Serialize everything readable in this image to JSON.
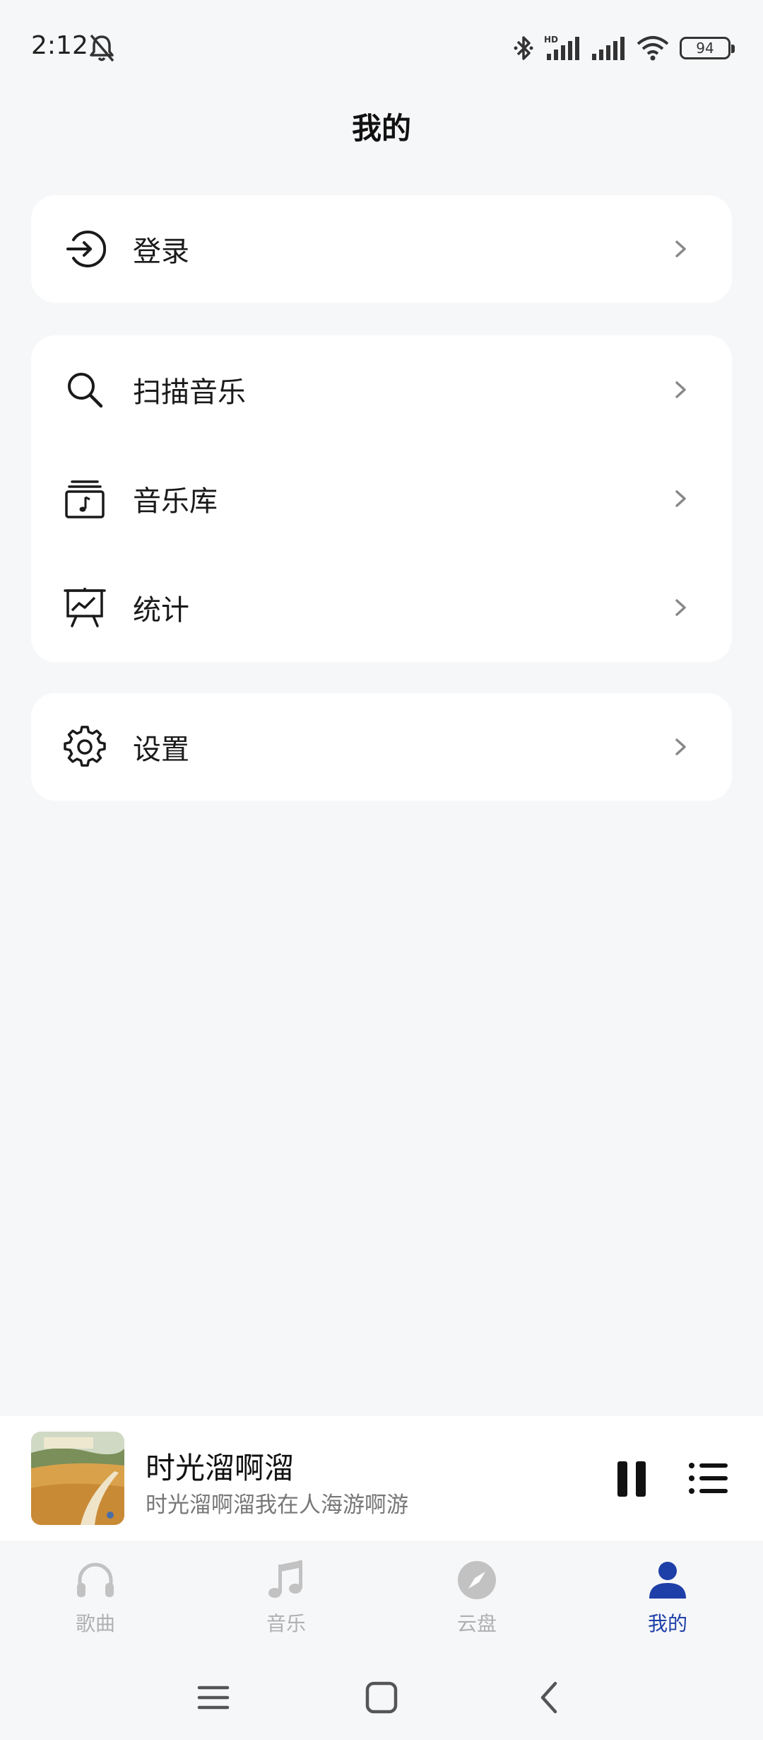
{
  "status_bar": {
    "time": "2:12",
    "battery": "94",
    "network": "HD"
  },
  "page": {
    "title": "我的"
  },
  "menu": {
    "login": {
      "label": "登录",
      "icon": "login-icon"
    },
    "tools": [
      {
        "label": "扫描音乐",
        "icon": "search-icon"
      },
      {
        "label": "音乐库",
        "icon": "music-library-icon"
      },
      {
        "label": "统计",
        "icon": "chart-board-icon"
      }
    ],
    "settings": {
      "label": "设置",
      "icon": "gear-icon"
    }
  },
  "player": {
    "title": "时光溜啊溜",
    "subtitle": "时光溜啊溜我在人海游啊游",
    "state": "playing"
  },
  "bottom_nav": [
    {
      "label": "歌曲",
      "icon": "headphones-icon",
      "active": false
    },
    {
      "label": "音乐",
      "icon": "music-note-icon",
      "active": false
    },
    {
      "label": "云盘",
      "icon": "compass-icon",
      "active": false
    },
    {
      "label": "我的",
      "icon": "person-icon",
      "active": true
    }
  ],
  "colors": {
    "accent": "#1e3fa8",
    "inactive": "#b0b0b0",
    "background": "#f6f7f9"
  }
}
